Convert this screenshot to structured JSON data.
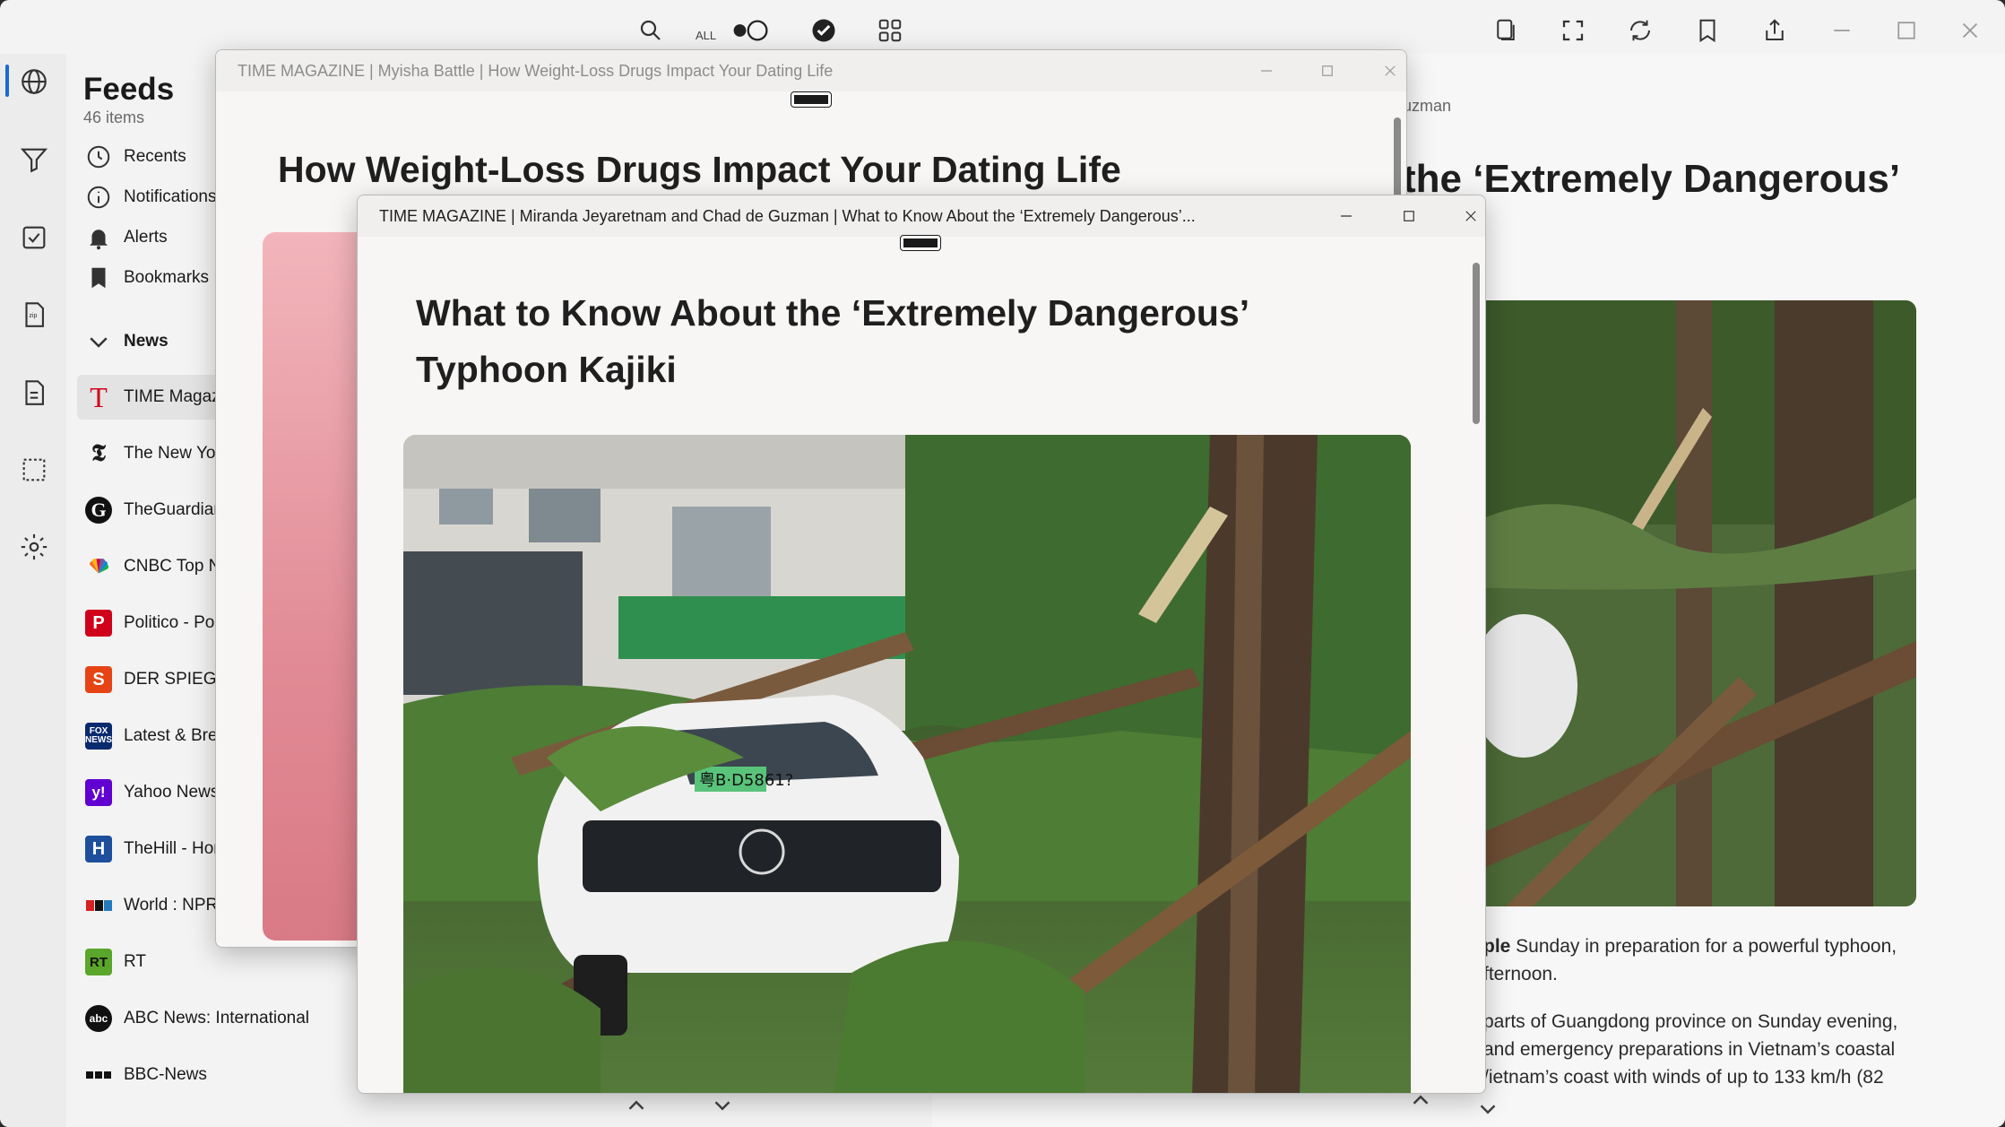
{
  "toolbar_left": {
    "icons": [
      "sidebar-toggle-icon",
      "sort-icon",
      "add-search-icon",
      "plus-icon"
    ]
  },
  "toolbar_main": {
    "filter_all_label": "ALL",
    "icons": [
      "search-icon",
      "toggle-icon",
      "check-circle-icon",
      "grid-icon",
      "copy-icon",
      "fullscreen-icon",
      "refresh-icon",
      "bookmark-icon",
      "share-icon"
    ]
  },
  "rail": {
    "icons": [
      "globe-icon",
      "filter-icon",
      "checkbox-icon",
      "zip-icon",
      "zip-doc-icon",
      "selection-icon",
      "gear-icon"
    ]
  },
  "feeds": {
    "title": "Feeds",
    "count": "46 items",
    "quick": [
      {
        "label": "Recents",
        "icon": "clock-icon"
      },
      {
        "label": "Notifications",
        "icon": "info-icon"
      },
      {
        "label": "Alerts",
        "icon": "bell-icon"
      },
      {
        "label": "Bookmarks",
        "icon": "bookmark-icon"
      }
    ],
    "group_label": "News",
    "sources": [
      {
        "label": "TIME Magazine",
        "badge": "T",
        "color": "#d0021b",
        "badge_text_color": "#d0021b"
      },
      {
        "label": "The New York",
        "badge": "𝕿",
        "color": "#111111"
      },
      {
        "label": "TheGuardian",
        "badge": "G",
        "color": "#111111"
      },
      {
        "label": "CNBC Top Ne",
        "badge": "nbc",
        "color": "#ffffff"
      },
      {
        "label": "Politico - Poli",
        "badge": "P",
        "color": "#d0021b"
      },
      {
        "label": "DER SPIEGEL",
        "badge": "S",
        "color": "#e64415"
      },
      {
        "label": "Latest & Brea",
        "badge": "FOX",
        "color": "#0a2a6e"
      },
      {
        "label": "Yahoo News",
        "badge": "y!",
        "color": "#6001d2"
      },
      {
        "label": "TheHill - Hon",
        "badge": "H",
        "color": "#1d4f9c"
      },
      {
        "label": "World : NPR",
        "badge": "npr",
        "color": "#ffffff"
      },
      {
        "label": "RT",
        "badge": "RT",
        "color": "#5aa62b"
      },
      {
        "label": "ABC News: International",
        "badge": "abc",
        "color": "#111111"
      },
      {
        "label": "BBC-News",
        "badge": "BBC",
        "color": "#111111"
      }
    ]
  },
  "background_article": {
    "author_fragment": "uzman",
    "title_fragment": "the ‘Extremely Dangerous’",
    "para1_bold": "ple",
    "para1_line1": " Sunday in preparation for a powerful typhoon,",
    "para1_line2": "fternoon.",
    "para2_line1": "parts of Guangdong province on Sunday evening,",
    "para2_line2": "and emergency preparations in Vietnam’s coastal",
    "para2_line3": "/ietnam’s coast with winds of up to 133 km/h (82"
  },
  "popup1": {
    "title": "TIME MAGAZINE | Myisha Battle | How Weight-Loss Drugs Impact Your Dating Life",
    "heading": "How Weight-Loss Drugs Impact Your Dating Life"
  },
  "popup2": {
    "title": "TIME MAGAZINE | Miranda Jeyaretnam and Chad de Guzman | What to Know About the ‘Extremely Dangerous’...",
    "heading": "What to Know About the ‘Extremely Dangerous’ Typhoon Kajiki",
    "plate_text": "粤B·D5861?"
  }
}
